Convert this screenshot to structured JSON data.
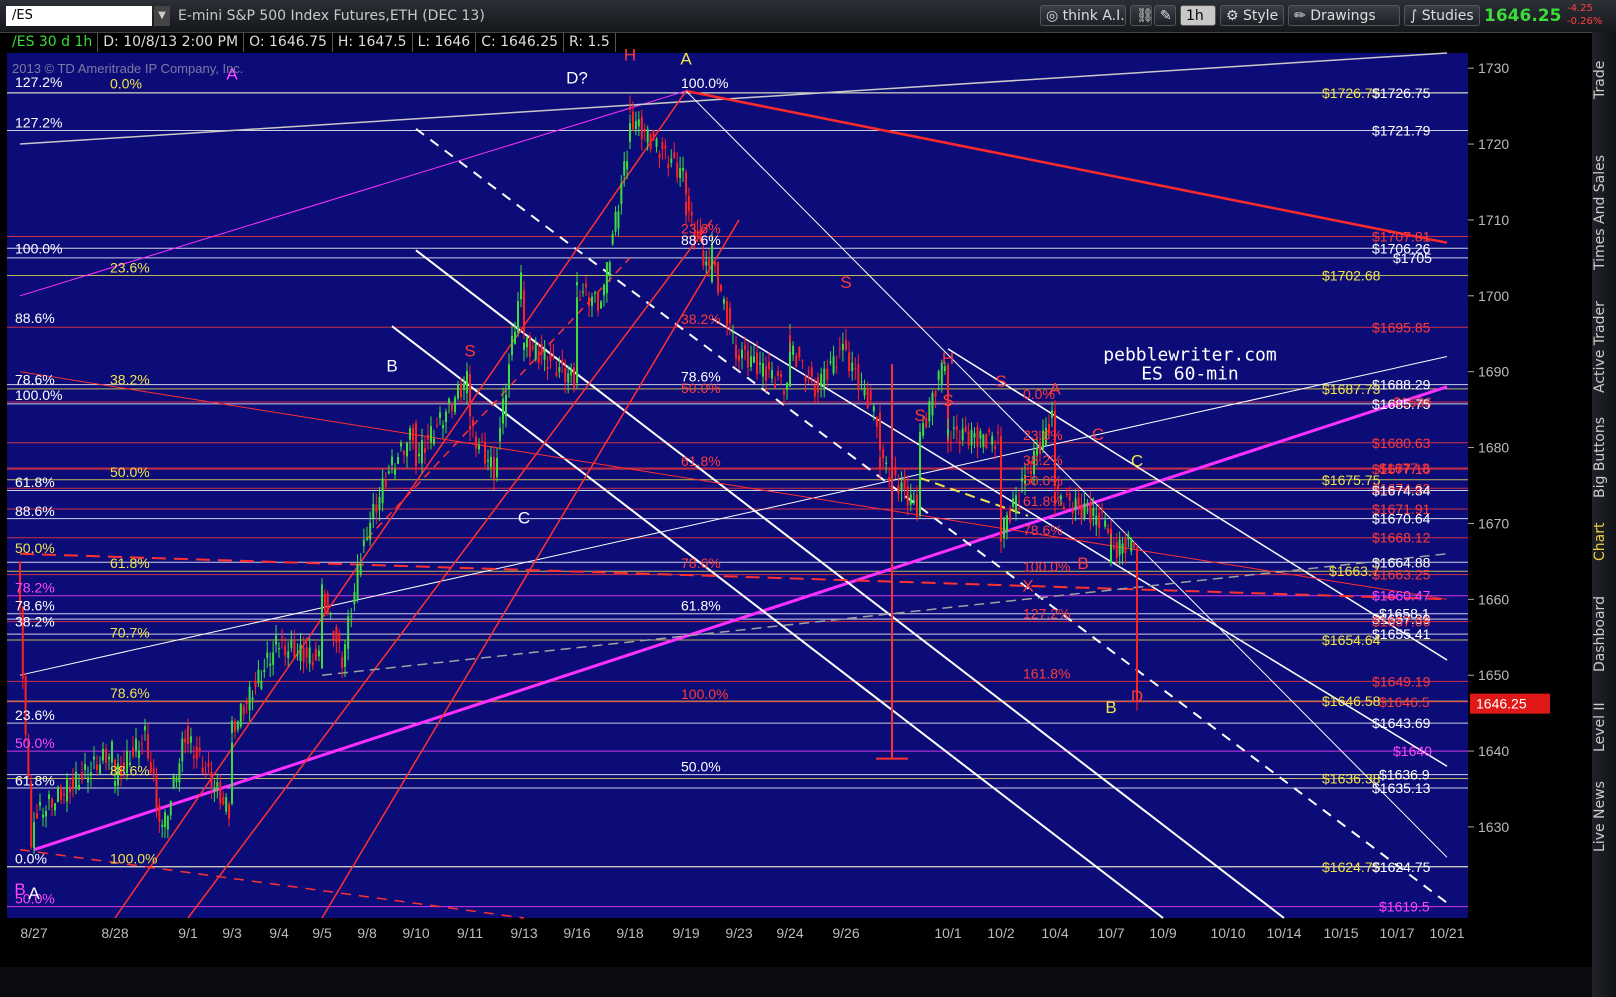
{
  "toolbar": {
    "symbol": "/ES",
    "description": "E-mini S&P 500 Index Futures,ETH (DEC 13)",
    "think_ai": "think A.I.",
    "timeframe": "1h",
    "style": "Style",
    "drawings": "Drawings",
    "studies": "Studies",
    "last_price": "1646.25",
    "change": "-4.25",
    "change_pct": "-0.26%"
  },
  "info_bar": {
    "symbol_period": "/ES 30 d 1h",
    "date": "D: 10/8/13 2:00 PM",
    "open": "O: 1646.75",
    "high": "H: 1647.5",
    "low": "L: 1646",
    "close": "C: 1646.25",
    "range": "R: 1.5"
  },
  "side_tabs": [
    "Trade",
    "Times And Sales",
    "Active Trader",
    "Big Buttons",
    "Chart",
    "Dashboard",
    "Level II",
    "Live News"
  ],
  "chart_data": {
    "type": "candlestick",
    "copyright": "2013 © TD Ameritrade IP Company, Inc.",
    "watermark": [
      "pebblewriter.com",
      "ES 60-min"
    ],
    "current_price_label": "1646.25",
    "colors": {
      "background": "#0c0c78",
      "up": "#3cdc3c",
      "down": "#ff2020",
      "fib_yellow": "#e8e050",
      "fib_red": "#ff3030",
      "trend_magenta": "#ff30ff",
      "channel_white": "#ffffff"
    },
    "ylim": [
      1618,
      1732
    ],
    "y_ticks": [
      1630,
      1640,
      1650,
      1660,
      1670,
      1680,
      1690,
      1700,
      1710,
      1720,
      1730
    ],
    "x_ticks": [
      "8/27",
      "8/28",
      "9/1",
      "9/3",
      "9/4",
      "9/5",
      "9/8",
      "9/10",
      "9/11",
      "9/13",
      "9/16",
      "9/18",
      "9/19",
      "9/23",
      "9/24",
      "9/26",
      "10/1",
      "10/2",
      "10/4",
      "10/7",
      "10/9",
      "10/10",
      "10/14",
      "10/15",
      "10/17",
      "10/21"
    ],
    "price_path": [
      [
        "8/26",
        1665
      ],
      [
        "8/27",
        1628
      ],
      [
        "8/27",
        1631
      ],
      [
        "8/28",
        1640
      ],
      [
        "8/28",
        1636
      ],
      [
        "8/29",
        1642
      ],
      [
        "8/30",
        1629
      ],
      [
        "9/1",
        1642
      ],
      [
        "9/3",
        1632
      ],
      [
        "9/3",
        1642
      ],
      [
        "9/4",
        1654
      ],
      [
        "9/5",
        1652
      ],
      [
        "9/5",
        1662
      ],
      [
        "9/6",
        1652
      ],
      [
        "9/8",
        1668
      ],
      [
        "9/9",
        1677
      ],
      [
        "9/10",
        1682
      ],
      [
        "9/10",
        1678
      ],
      [
        "9/11",
        1689
      ],
      [
        "9/11",
        1683
      ],
      [
        "9/12",
        1677
      ],
      [
        "9/13",
        1702
      ],
      [
        "9/13",
        1694
      ],
      [
        "9/16",
        1689
      ],
      [
        "9/16",
        1701
      ],
      [
        "9/17",
        1699
      ],
      [
        "9/18",
        1719
      ],
      [
        "9/18",
        1724
      ],
      [
        "9/19",
        1716
      ],
      [
        "9/19",
        1713
      ],
      [
        "9/20",
        1703
      ],
      [
        "9/20",
        1706
      ],
      [
        "9/23",
        1693
      ],
      [
        "9/24",
        1688
      ],
      [
        "9/24",
        1694
      ],
      [
        "9/25",
        1688
      ],
      [
        "9/26",
        1693
      ],
      [
        "9/27",
        1684
      ],
      [
        "9/27",
        1679
      ],
      [
        "9/30",
        1672
      ],
      [
        "9/30",
        1680
      ],
      [
        "10/1",
        1692
      ],
      [
        "10/1",
        1682
      ],
      [
        "10/2",
        1681
      ],
      [
        "10/2",
        1668
      ],
      [
        "10/3",
        1676
      ],
      [
        "10/4",
        1684
      ],
      [
        "10/4",
        1674
      ],
      [
        "10/7",
        1670
      ],
      [
        "10/7",
        1666
      ],
      [
        "10/8",
        1668
      ],
      [
        "10/8",
        1649
      ],
      [
        "10/8",
        1646.25
      ]
    ],
    "right_price_labels": [
      {
        "text": "$1726.75",
        "value": 1726.75,
        "color": "yellow"
      },
      {
        "text": "$1726.75",
        "value": 1726.75,
        "color": "white"
      },
      {
        "text": "$1721.79",
        "value": 1721.79,
        "color": "white"
      },
      {
        "text": "$1707.81",
        "value": 1707.81,
        "color": "red"
      },
      {
        "text": "$1706.26",
        "value": 1706.26,
        "color": "white"
      },
      {
        "text": "$1705",
        "value": 1705,
        "color": "white"
      },
      {
        "text": "$1702.68",
        "value": 1702.68,
        "color": "yellow"
      },
      {
        "text": "$1695.85",
        "value": 1695.85,
        "color": "red"
      },
      {
        "text": "$1688.29",
        "value": 1688.29,
        "color": "white"
      },
      {
        "text": "$1687.73",
        "value": 1687.73,
        "color": "yellow"
      },
      {
        "text": "$1686",
        "value": 1686,
        "color": "red"
      },
      {
        "text": "$1685.75",
        "value": 1685.75,
        "color": "white"
      },
      {
        "text": "$1680.63",
        "value": 1680.63,
        "color": "red"
      },
      {
        "text": "$1677.16",
        "value": 1677.16,
        "color": "red"
      },
      {
        "text": "$1677.3",
        "value": 1677.3,
        "color": "red"
      },
      {
        "text": "$1675.75",
        "value": 1675.75,
        "color": "yellow"
      },
      {
        "text": "$1674.63",
        "value": 1674.63,
        "color": "red"
      },
      {
        "text": "$1674.34",
        "value": 1674.34,
        "color": "white"
      },
      {
        "text": "$1671.91",
        "value": 1671.91,
        "color": "red"
      },
      {
        "text": "$1670.64",
        "value": 1670.64,
        "color": "white"
      },
      {
        "text": "$1668.12",
        "value": 1668.12,
        "color": "red"
      },
      {
        "text": "$1664.88",
        "value": 1664.88,
        "color": "white"
      },
      {
        "text": "$1663.7",
        "value": 1663.7,
        "color": "yellow"
      },
      {
        "text": "$1663.25",
        "value": 1663.25,
        "color": "red"
      },
      {
        "text": "$1660.47",
        "value": 1660.47,
        "color": "magenta"
      },
      {
        "text": "$1658.1",
        "value": 1658.1,
        "color": "white"
      },
      {
        "text": "$1657.39",
        "value": 1657.39,
        "color": "white"
      },
      {
        "text": "$1657.06",
        "value": 1657.06,
        "color": "red"
      },
      {
        "text": "$1655.41",
        "value": 1655.41,
        "color": "white"
      },
      {
        "text": "$1654.64",
        "value": 1654.64,
        "color": "yellow"
      },
      {
        "text": "$1649.19",
        "value": 1649.19,
        "color": "red"
      },
      {
        "text": "$1646.58",
        "value": 1646.58,
        "color": "yellow"
      },
      {
        "text": "$1646.5",
        "value": 1646.5,
        "color": "red"
      },
      {
        "text": "$1643.69",
        "value": 1643.69,
        "color": "white"
      },
      {
        "text": "$1640",
        "value": 1640,
        "color": "magenta"
      },
      {
        "text": "$1636.9",
        "value": 1636.9,
        "color": "white"
      },
      {
        "text": "$1636.38",
        "value": 1636.38,
        "color": "yellow"
      },
      {
        "text": "$1635.13",
        "value": 1635.13,
        "color": "white"
      },
      {
        "text": "$1624.75",
        "value": 1624.75,
        "color": "yellow"
      },
      {
        "text": "$1624.75",
        "value": 1624.75,
        "color": "white"
      },
      {
        "text": "$1619.5",
        "value": 1619.5,
        "color": "magenta"
      }
    ],
    "fib_labels": [
      {
        "text": "127.2%",
        "x": "8/26",
        "value": 1727.1,
        "color": "white"
      },
      {
        "text": "0.0%",
        "x": "8/28",
        "value": 1726.9,
        "color": "yellow"
      },
      {
        "text": "127.2%",
        "x": "8/26",
        "value": 1721.8,
        "color": "white"
      },
      {
        "text": "100.0%",
        "x": "8/26",
        "value": 1705.2,
        "color": "white"
      },
      {
        "text": "23.6%",
        "x": "8/28",
        "value": 1702.7,
        "color": "yellow"
      },
      {
        "text": "88.6%",
        "x": "8/26",
        "value": 1696.0,
        "color": "white"
      },
      {
        "text": "78.6%",
        "x": "8/26",
        "value": 1687.9,
        "color": "white"
      },
      {
        "text": "38.2%",
        "x": "8/28",
        "value": 1687.9,
        "color": "yellow"
      },
      {
        "text": "100.0%",
        "x": "8/26",
        "value": 1685.9,
        "color": "white"
      },
      {
        "text": "50.0%",
        "x": "8/28",
        "value": 1675.7,
        "color": "yellow"
      },
      {
        "text": "61.8%",
        "x": "8/26",
        "value": 1674.4,
        "color": "white"
      },
      {
        "text": "88.6%",
        "x": "8/26",
        "value": 1670.6,
        "color": "white"
      },
      {
        "text": "50.0%",
        "x": "8/26",
        "value": 1665.7,
        "color": "yellow"
      },
      {
        "text": "61.8%",
        "x": "8/28",
        "value": 1663.7,
        "color": "yellow"
      },
      {
        "text": "78.2%",
        "x": "8/26",
        "value": 1660.5,
        "color": "magenta"
      },
      {
        "text": "78.6%",
        "x": "8/26",
        "value": 1658.1,
        "color": "white"
      },
      {
        "text": "38.2%",
        "x": "8/26",
        "value": 1656.0,
        "color": "white"
      },
      {
        "text": "70.7%",
        "x": "8/28",
        "value": 1654.6,
        "color": "yellow"
      },
      {
        "text": "78.6%",
        "x": "8/28",
        "value": 1646.6,
        "color": "yellow"
      },
      {
        "text": "23.6%",
        "x": "8/26",
        "value": 1643.7,
        "color": "white"
      },
      {
        "text": "50.0%",
        "x": "8/26",
        "value": 1640.0,
        "color": "magenta"
      },
      {
        "text": "88.6%",
        "x": "8/28",
        "value": 1636.4,
        "color": "yellow"
      },
      {
        "text": "61.8%",
        "x": "8/26",
        "value": 1635.1,
        "color": "white"
      },
      {
        "text": "0.0%",
        "x": "8/26",
        "value": 1624.8,
        "color": "white"
      },
      {
        "text": "100.0%",
        "x": "8/28",
        "value": 1624.8,
        "color": "yellow"
      },
      {
        "text": "50.0%",
        "x": "8/26",
        "value": 1619.5,
        "color": "magenta"
      },
      {
        "text": "100.0%",
        "x": "9/19",
        "value": 1727.0,
        "color": "white"
      },
      {
        "text": "23.6%",
        "x": "9/19",
        "value": 1707.8,
        "color": "red"
      },
      {
        "text": "88.6%",
        "x": "9/19",
        "value": 1706.3,
        "color": "white"
      },
      {
        "text": "38.2%",
        "x": "9/19",
        "value": 1695.9,
        "color": "red"
      },
      {
        "text": "78.6%",
        "x": "9/19",
        "value": 1688.3,
        "color": "white"
      },
      {
        "text": "50.0%",
        "x": "9/19",
        "value": 1686.8,
        "color": "red"
      },
      {
        "text": "61.8%",
        "x": "9/19",
        "value": 1677.2,
        "color": "red"
      },
      {
        "text": "78.6%",
        "x": "9/19",
        "value": 1663.7,
        "color": "red"
      },
      {
        "text": "61.8%",
        "x": "9/19",
        "value": 1658.1,
        "color": "white"
      },
      {
        "text": "100.0%",
        "x": "9/19",
        "value": 1646.5,
        "color": "red"
      },
      {
        "text": "50.0%",
        "x": "9/19",
        "value": 1636.9,
        "color": "white"
      },
      {
        "text": "0.0%",
        "x": "10/3",
        "value": 1686.0,
        "color": "red"
      },
      {
        "text": "23.6%",
        "x": "10/3",
        "value": 1680.6,
        "color": "red"
      },
      {
        "text": "38.2%",
        "x": "10/3",
        "value": 1677.3,
        "color": "red"
      },
      {
        "text": "50.0%",
        "x": "10/3",
        "value": 1674.6,
        "color": "red"
      },
      {
        "text": "61.8%",
        "x": "10/3",
        "value": 1671.9,
        "color": "red"
      },
      {
        "text": "78.6%",
        "x": "10/3",
        "value": 1668.1,
        "color": "red"
      },
      {
        "text": "100.0%",
        "x": "10/3",
        "value": 1663.3,
        "color": "red"
      },
      {
        "text": "127.2%",
        "x": "10/3",
        "value": 1657.1,
        "color": "red"
      },
      {
        "text": "161.8%",
        "x": "10/3",
        "value": 1649.2,
        "color": "red"
      }
    ],
    "wave_labels": [
      {
        "text": "A",
        "x": "9/3",
        "value": 1728.5,
        "color": "magenta"
      },
      {
        "text": "D?",
        "x": "9/16",
        "value": 1728.0,
        "color": "white"
      },
      {
        "text": "H",
        "x": "9/18",
        "value": 1731.0,
        "color": "red"
      },
      {
        "text": "A",
        "x": "9/19",
        "value": 1730.5,
        "color": "yellow"
      },
      {
        "text": "B",
        "x": "9/9",
        "value": 1690.0,
        "color": "white"
      },
      {
        "text": "S",
        "x": "9/11",
        "value": 1692.0,
        "color": "red"
      },
      {
        "text": "C",
        "x": "9/13",
        "value": 1670.0,
        "color": "white"
      },
      {
        "text": "S",
        "x": "9/26",
        "value": 1701.0,
        "color": "red"
      },
      {
        "text": "H",
        "x": "10/1",
        "value": 1691.0,
        "color": "red"
      },
      {
        "text": "S",
        "x": "10/2",
        "value": 1688.0,
        "color": "red"
      },
      {
        "text": "S",
        "x": "9/30",
        "value": 1683.5,
        "color": "red"
      },
      {
        "text": "S",
        "x": "10/1",
        "value": 1685.5,
        "color": "red"
      },
      {
        "text": "A",
        "x": "10/4",
        "value": 1687.0,
        "color": "red"
      },
      {
        "text": "C",
        "x": "10/6",
        "value": 1681.0,
        "color": "red"
      },
      {
        "text": "C",
        "x": "10/8",
        "value": 1677.5,
        "color": "yellow"
      },
      {
        "text": "B",
        "x": "10/5",
        "value": 1664.0,
        "color": "red"
      },
      {
        "text": "X",
        "x": "10/3",
        "value": 1661.0,
        "color": "red"
      },
      {
        "text": "B",
        "x": "10/7",
        "value": 1645.0,
        "color": "yellow"
      },
      {
        "text": "D",
        "x": "10/8",
        "value": 1646.5,
        "color": "red"
      },
      {
        "text": "B",
        "x": "8/26",
        "value": 1621.0,
        "color": "magenta"
      },
      {
        "text": "A",
        "x": "8/27",
        "value": 1620.5,
        "color": "white"
      }
    ]
  }
}
